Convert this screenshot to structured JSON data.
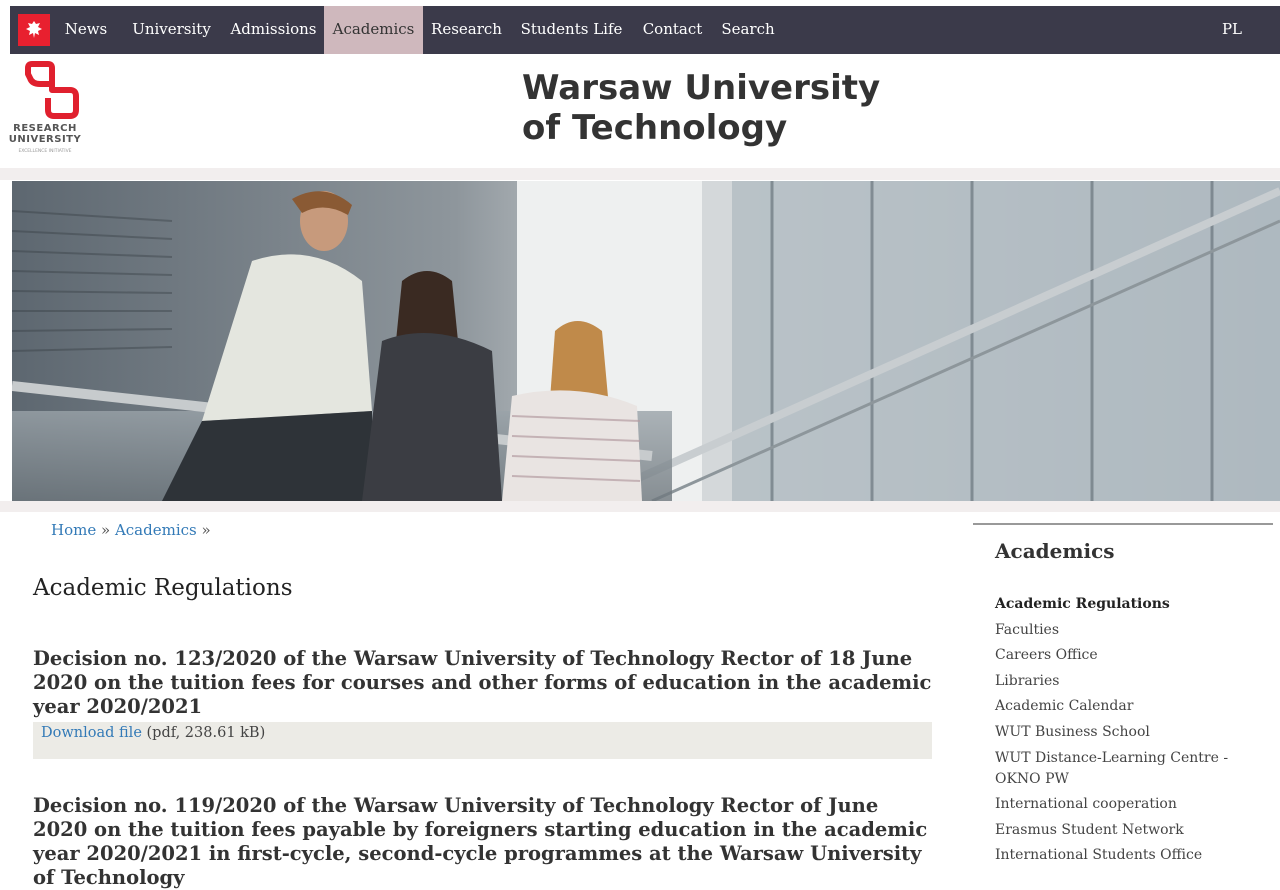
{
  "nav": {
    "items": [
      {
        "label": "News"
      },
      {
        "label": "University"
      },
      {
        "label": "Admissions"
      },
      {
        "label": "Academics",
        "active": true
      },
      {
        "label": "Research"
      },
      {
        "label": "Students Life"
      },
      {
        "label": "Contact"
      },
      {
        "label": "Search"
      }
    ],
    "lang": "PL"
  },
  "header": {
    "logo_text_1": "RESEARCH",
    "logo_text_2": "UNIVERSITY",
    "logo_text_3": "EXCELLENCE INITIATIVE",
    "title_line_1": "Warsaw University",
    "title_line_2": "of Technology"
  },
  "breadcrumb": {
    "home": "Home",
    "sep1": " » ",
    "academics": "Academics",
    "sep2": " »"
  },
  "main": {
    "page_title": "Academic Regulations",
    "documents": [
      {
        "title": "Decision no. 123/2020 of the Warsaw University of Technology Rector of 18 June 2020 on the tuition fees for courses and other forms of education in the academic year 2020/2021",
        "link_label": "Download file",
        "meta": " (pdf, 238.61 kB)"
      },
      {
        "title": "Decision no. 119/2020 of the Warsaw University of Technology Rector of June 2020 on the tuition fees payable by foreigners starting education in the academic year 2020/2021 in first-cycle, second-cycle programmes at the Warsaw University of Technology"
      }
    ]
  },
  "sidebar": {
    "heading": "Academics",
    "items": [
      {
        "label": "Academic Regulations",
        "current": true
      },
      {
        "label": "Faculties"
      },
      {
        "label": "Careers Office"
      },
      {
        "label": "Libraries"
      },
      {
        "label": "Academic Calendar"
      },
      {
        "label": "WUT Business School"
      },
      {
        "label": "WUT Distance-Learning Centre - OKNO PW"
      },
      {
        "label": "International cooperation"
      },
      {
        "label": "Erasmus Student Network"
      },
      {
        "label": "International Students Office"
      }
    ]
  },
  "colors": {
    "nav_bg": "#3b3a4a",
    "nav_active_bg": "#cfb8bd",
    "logo_red": "#e0202e",
    "link": "#337ab7",
    "download_bg": "#ecebe6"
  }
}
